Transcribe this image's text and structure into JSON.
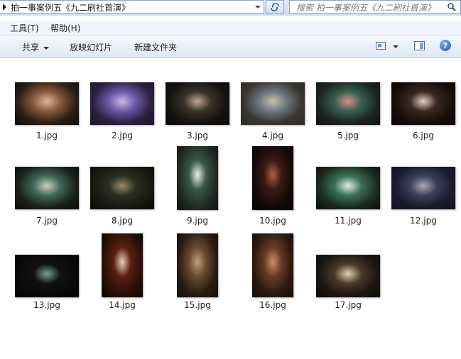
{
  "address": {
    "path": "拍一事案例五《九二刷社首演》"
  },
  "search": {
    "placeholder": "搜索 拍一事案例五《九二刷社首演》"
  },
  "menu": {
    "tools": "工具(T)",
    "help": "帮助(H)"
  },
  "toolbar": {
    "share": "共享",
    "slideshow": "放映幻灯片",
    "new_folder": "新建文件夹",
    "help_icon": "?"
  },
  "files": [
    {
      "name": "1.jpg",
      "orient": "landscape",
      "colors": [
        "#0d0b0a",
        "#8a5a3c",
        "#d7b7a0",
        "#2a1e18"
      ]
    },
    {
      "name": "2.jpg",
      "orient": "landscape",
      "colors": [
        "#1a1530",
        "#6b5aa8",
        "#c8b8e6",
        "#2b2040"
      ]
    },
    {
      "name": "3.jpg",
      "orient": "landscape",
      "colors": [
        "#0a0a08",
        "#3a3428",
        "#c0a890",
        "#141210"
      ]
    },
    {
      "name": "4.jpg",
      "orient": "landscape",
      "colors": [
        "#2a2e30",
        "#6a7a80",
        "#c8c0a8",
        "#3a3430"
      ]
    },
    {
      "name": "5.jpg",
      "orient": "landscape",
      "colors": [
        "#0e1412",
        "#3a6050",
        "#d09088",
        "#1a2420"
      ]
    },
    {
      "name": "6.jpg",
      "orient": "landscape",
      "colors": [
        "#070606",
        "#3a2820",
        "#e0d0c0",
        "#180e0a"
      ]
    },
    {
      "name": "7.jpg",
      "orient": "landscape",
      "colors": [
        "#0a0c0a",
        "#406858",
        "#c8d0b8",
        "#1a201a"
      ]
    },
    {
      "name": "8.jpg",
      "orient": "landscape",
      "colors": [
        "#0a0a08",
        "#2a3020",
        "#9a8a6a",
        "#1a1810"
      ]
    },
    {
      "name": "9.jpg",
      "orient": "portrait",
      "colors": [
        "#101410",
        "#3a5848",
        "#e8f0e8",
        "#202a24"
      ]
    },
    {
      "name": "10.jpg",
      "orient": "portrait",
      "colors": [
        "#060404",
        "#3a1a14",
        "#b06048",
        "#140a08"
      ]
    },
    {
      "name": "11.jpg",
      "orient": "landscape",
      "colors": [
        "#0a100c",
        "#3a7058",
        "#e0f0e0",
        "#1a2a20"
      ]
    },
    {
      "name": "12.jpg",
      "orient": "landscape",
      "colors": [
        "#121420",
        "#3a4058",
        "#b0a8b8",
        "#1a1a2a"
      ]
    },
    {
      "name": "13.jpg",
      "orient": "landscape",
      "colors": [
        "#040404",
        "#101010",
        "#7aa090",
        "#0a0a0a"
      ]
    },
    {
      "name": "14.jpg",
      "orient": "portrait",
      "colors": [
        "#0a0604",
        "#5a2010",
        "#e8d0c0",
        "#2a1008"
      ]
    },
    {
      "name": "15.jpg",
      "orient": "portrait",
      "colors": [
        "#120e0a",
        "#6a4a30",
        "#c0a080",
        "#281c14"
      ]
    },
    {
      "name": "16.jpg",
      "orient": "portrait",
      "colors": [
        "#140e0a",
        "#6a3a24",
        "#c89070",
        "#2a1a10"
      ]
    },
    {
      "name": "17.jpg",
      "orient": "landscape",
      "colors": [
        "#0e0c08",
        "#4a3a2a",
        "#e0d0b8",
        "#1c1610"
      ]
    }
  ]
}
